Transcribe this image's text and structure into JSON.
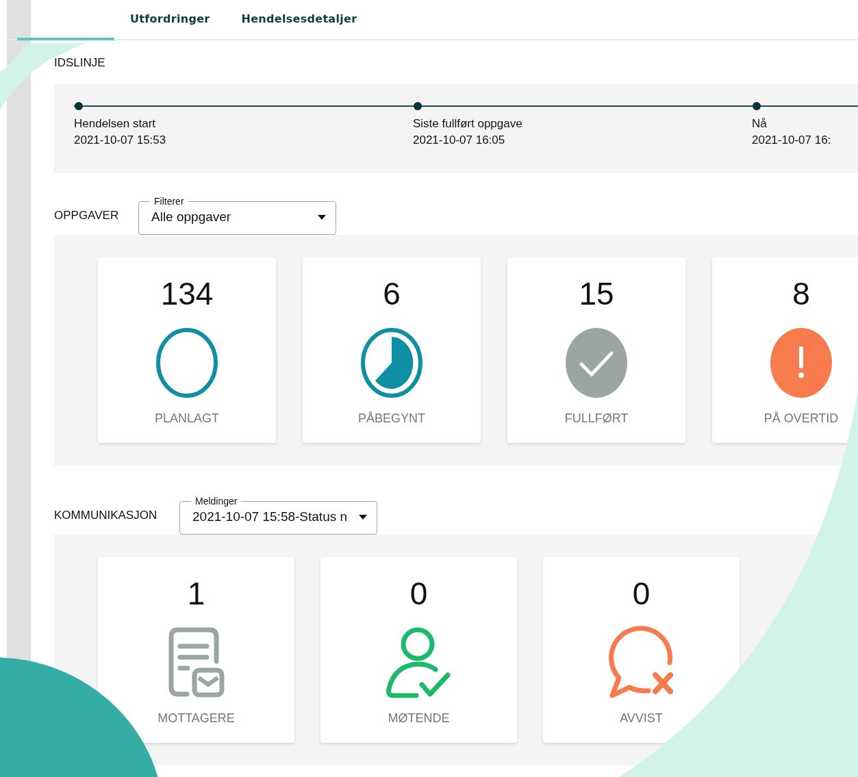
{
  "tabs": [
    {
      "selected": true
    },
    {
      "label": "Utfordringer",
      "selected": false
    },
    {
      "label": "Hendelsesdetaljer",
      "selected": false
    }
  ],
  "timeline": {
    "heading": "IDSLINJE",
    "events": [
      {
        "title": "Hendelsen start",
        "time": "2021-10-07 15:53"
      },
      {
        "title": "Siste fullført oppgave",
        "time": "2021-10-07 16:05"
      },
      {
        "title": "Nå",
        "time": "2021-10-07 16:"
      }
    ]
  },
  "tasks": {
    "heading": "OPPGAVER",
    "filter": {
      "label": "Filterer",
      "value": "Alle oppgaver"
    },
    "cards": [
      {
        "kind": "planned",
        "count": "134",
        "label": "PLANLAGT"
      },
      {
        "kind": "started",
        "count": "6",
        "label": "PÅBEGYNT"
      },
      {
        "kind": "done",
        "count": "15",
        "label": "FULLFØRT"
      },
      {
        "kind": "overdue",
        "count": "8",
        "label": "PÅ OVERTID"
      }
    ]
  },
  "communication": {
    "heading": "KOMMUNIKASJON",
    "filter": {
      "label": "Meldinger",
      "value": "2021-10-07 15:58-Status n"
    },
    "cards": [
      {
        "kind": "recipients",
        "count": "1",
        "label": "MOTTAGERE"
      },
      {
        "kind": "attending",
        "count": "0",
        "label": "MØTENDE"
      },
      {
        "kind": "rejected",
        "count": "0",
        "label": "AVVIST"
      }
    ]
  }
}
